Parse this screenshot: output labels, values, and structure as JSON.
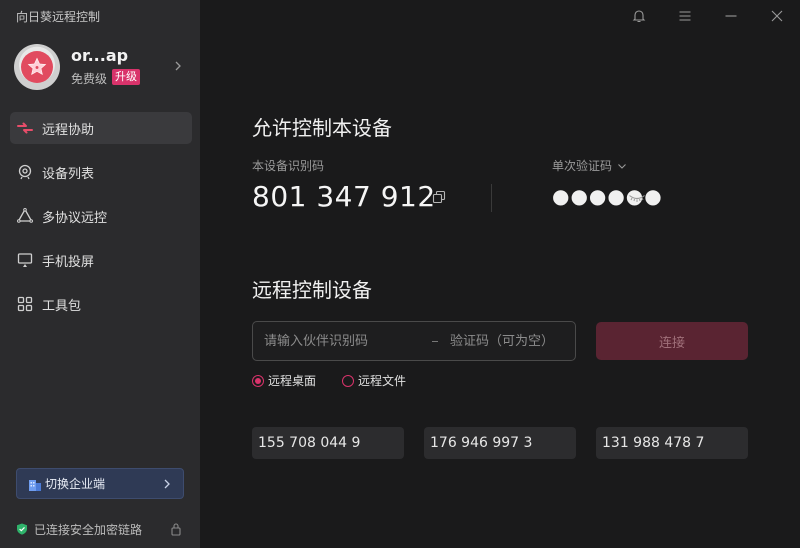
{
  "app": {
    "title": "向日葵远程控制"
  },
  "profile": {
    "name": "or...ap",
    "tier": "免费级",
    "upgrade": "升级"
  },
  "nav": {
    "items": [
      {
        "label": "远程协助",
        "icon": "remote-assist-icon"
      },
      {
        "label": "设备列表",
        "icon": "device-list-icon"
      },
      {
        "label": "多协议远控",
        "icon": "multi-protocol-icon"
      },
      {
        "label": "手机投屏",
        "icon": "screen-cast-icon"
      },
      {
        "label": "工具包",
        "icon": "toolkit-icon"
      }
    ]
  },
  "sidebar_footer": {
    "enterprise": "切换企业端",
    "secure": "已连接安全加密链路"
  },
  "allow_control": {
    "title": "允许控制本设备",
    "device_id_label": "本设备识别码",
    "device_id": "801 347 912",
    "code_label": "单次验证码",
    "code_masked": "●●●●●●"
  },
  "remote_control": {
    "title": "远程控制设备",
    "partner_placeholder": "请输入伙伴识别码",
    "code_placeholder": "验证码（可为空）",
    "connect": "连接",
    "mode_desktop": "远程桌面",
    "mode_file": "远程文件"
  },
  "history": [
    "155 708 044 9",
    "176 946 997 3",
    "131 988 478 7"
  ],
  "colors": {
    "accent": "#d9336b",
    "connect_bg": "#5a2432",
    "sidebar_bg": "#2b2b2d",
    "main_bg": "#1a1a1b"
  }
}
